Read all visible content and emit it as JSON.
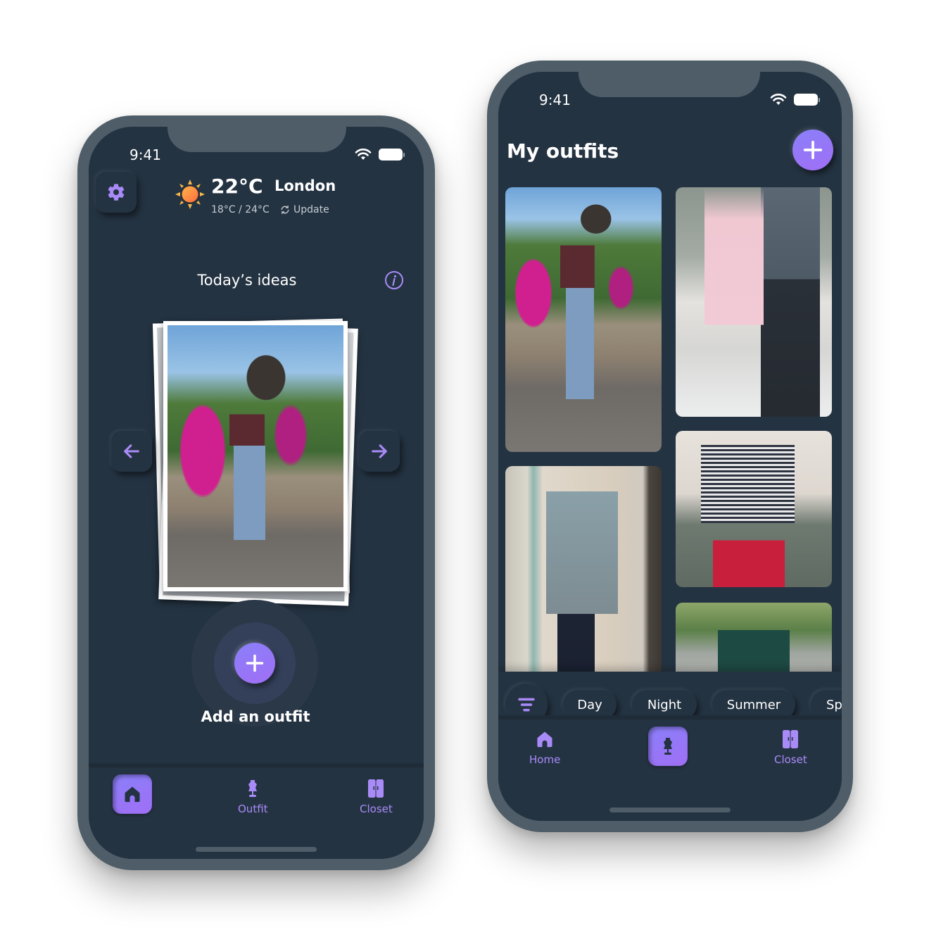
{
  "status_bar": {
    "time": "9:41"
  },
  "home_screen": {
    "weather": {
      "temperature": "22°C",
      "city": "London",
      "range": "18°C / 24°C",
      "update_label": "Update",
      "icon": "sun-icon"
    },
    "ideas_title": "Today’s ideas",
    "featured_photo": "Woman in bucket hat, floral sheer top and light jeans sitting on a stone wall with pink bougainvillea",
    "add_outfit_label": "Add an outfit",
    "tabs": [
      {
        "label": "Home",
        "icon": "home-icon",
        "active": true
      },
      {
        "label": "Outfit",
        "icon": "mannequin-icon",
        "active": false
      },
      {
        "label": "Closet",
        "icon": "wardrobe-icon",
        "active": false
      }
    ]
  },
  "outfits_screen": {
    "title": "My outfits",
    "outfits": [
      {
        "description": "Bucket hat, floral sheer top, light jeans, black sandals"
      },
      {
        "description": "Pink dress with black belt and heels, man in grey suit"
      },
      {
        "description": "Plaid blazer, blue shirt, navy trousers"
      },
      {
        "description": "Striped long-sleeve top with red skirt"
      },
      {
        "description": "Green jacket over floral top"
      }
    ],
    "filters": [
      "Day",
      "Night",
      "Summer",
      "Sp"
    ],
    "tabs": [
      {
        "label": "Home",
        "icon": "home-icon",
        "active": false
      },
      {
        "label": "Outfit",
        "icon": "mannequin-icon",
        "active": true
      },
      {
        "label": "Closet",
        "icon": "wardrobe-icon",
        "active": false
      }
    ]
  },
  "colors": {
    "background": "#243342",
    "frame": "#4e5d67",
    "accent": "#8f7cf8",
    "accent_text": "#a98bf8"
  }
}
